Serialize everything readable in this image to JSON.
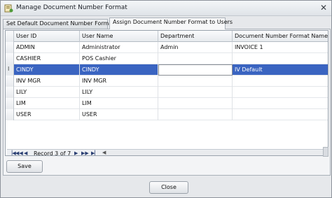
{
  "window": {
    "title": "Manage Document Number Format"
  },
  "tabs": [
    {
      "label": "Set Default Document Number Format",
      "active": false
    },
    {
      "label": "Assign Document Number Format to Users",
      "active": true
    }
  ],
  "grid": {
    "columns": [
      "User ID",
      "User Name",
      "Department",
      "Document Number Format Name"
    ],
    "rows": [
      [
        "ADMIN",
        "Administrator",
        "Admin",
        "INVOICE 1"
      ],
      [
        "CASHIER",
        "POS Cashier",
        "",
        ""
      ],
      [
        "CINDY",
        "CINDY",
        "",
        "IV Default"
      ],
      [
        "INV MGR",
        "INV MGR",
        "",
        ""
      ],
      [
        "LILY",
        "LILY",
        "",
        ""
      ],
      [
        "LIM",
        "LIM",
        "",
        ""
      ],
      [
        "USER",
        "USER",
        "",
        ""
      ]
    ],
    "selected_row": 2,
    "navigator": {
      "record_text": "Record 3 of 7"
    }
  },
  "buttons": {
    "save": "Save",
    "close": "Close"
  },
  "icons": {
    "first": "first-record-icon",
    "prev": "prev-record-icon",
    "next": "next-record-icon",
    "last": "last-record-icon"
  },
  "colors": {
    "selection": "#3a64c1"
  }
}
